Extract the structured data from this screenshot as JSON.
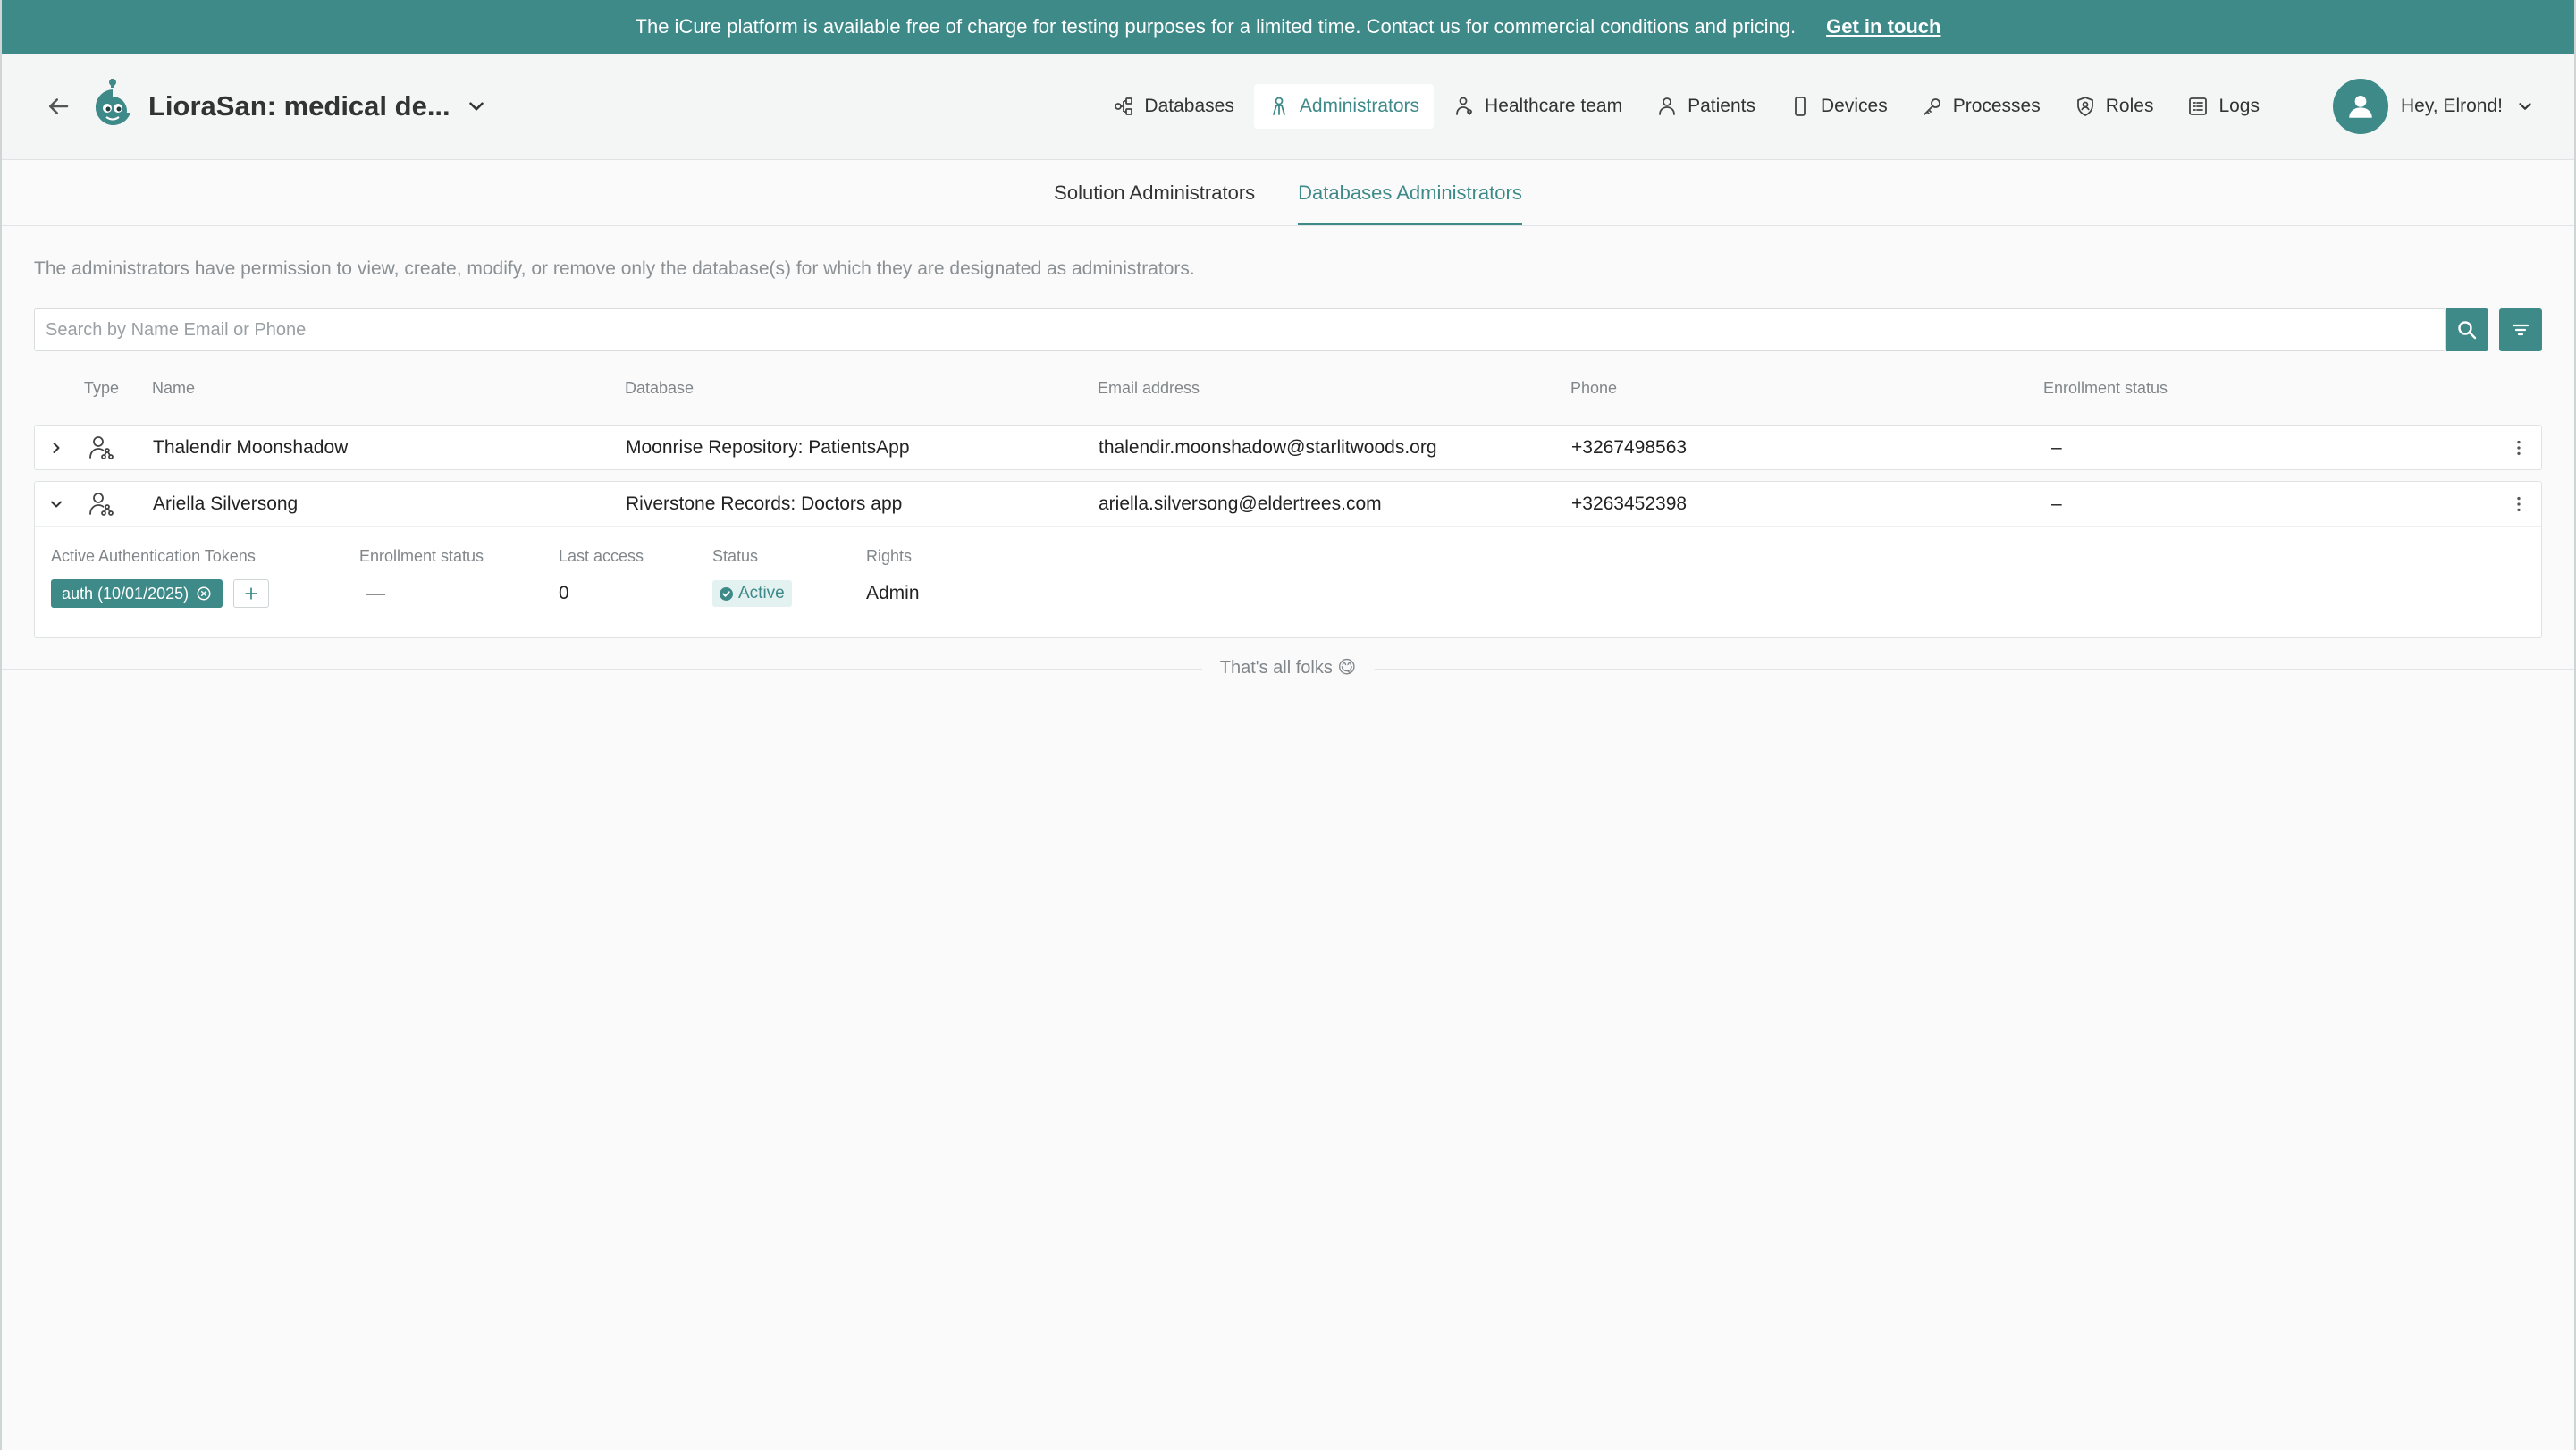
{
  "banner": {
    "message": "The iCure platform is available free of charge for testing purposes for a limited time. Contact us for commercial conditions and pricing.",
    "link": "Get in touch"
  },
  "header": {
    "app_title": "LioraSan: medical de...",
    "nav": [
      {
        "label": "Databases",
        "icon": "databases-icon"
      },
      {
        "label": "Administrators",
        "icon": "administrators-icon",
        "active": true
      },
      {
        "label": "Healthcare team",
        "icon": "healthcare-team-icon"
      },
      {
        "label": "Patients",
        "icon": "patients-icon"
      },
      {
        "label": "Devices",
        "icon": "devices-icon"
      },
      {
        "label": "Processes",
        "icon": "processes-icon"
      },
      {
        "label": "Roles",
        "icon": "roles-icon"
      },
      {
        "label": "Logs",
        "icon": "logs-icon"
      }
    ],
    "user_greeting": "Hey, Elrond!"
  },
  "tabs": [
    {
      "label": "Solution Administrators",
      "active": false
    },
    {
      "label": "Databases Administrators",
      "active": true
    }
  ],
  "description": "The administrators have permission to view, create, modify, or remove only the database(s) for which they are designated as administrators.",
  "search": {
    "placeholder": "Search by Name Email or Phone",
    "value": ""
  },
  "table": {
    "columns": [
      "Type",
      "Name",
      "Database",
      "Email address",
      "Phone",
      "Enrollment status"
    ],
    "rows": [
      {
        "name": "Thalendir Moonshadow",
        "database": "Moonrise Repository: PatientsApp",
        "email": "thalendir.moonshadow@starlitwoods.org",
        "phone": "+3267498563",
        "enrollment": "–",
        "expanded": false
      },
      {
        "name": "Ariella Silversong",
        "database": "Riverstone Records: Doctors app",
        "email": "ariella.silversong@eldertrees.com",
        "phone": "+3263452398",
        "enrollment": "–",
        "expanded": true
      }
    ],
    "details": {
      "labels": {
        "tokens": "Active Authentication Tokens",
        "enrollment": "Enrollment status",
        "last_access": "Last access",
        "status": "Status",
        "rights": "Rights"
      },
      "token": "auth (10/01/2025)",
      "enrollment": "—",
      "last_access": "0",
      "status": "Active",
      "rights": "Admin"
    }
  },
  "footer": "That's all folks 😋",
  "colors": {
    "accent": "#3d8a89",
    "background": "#fafafa"
  }
}
